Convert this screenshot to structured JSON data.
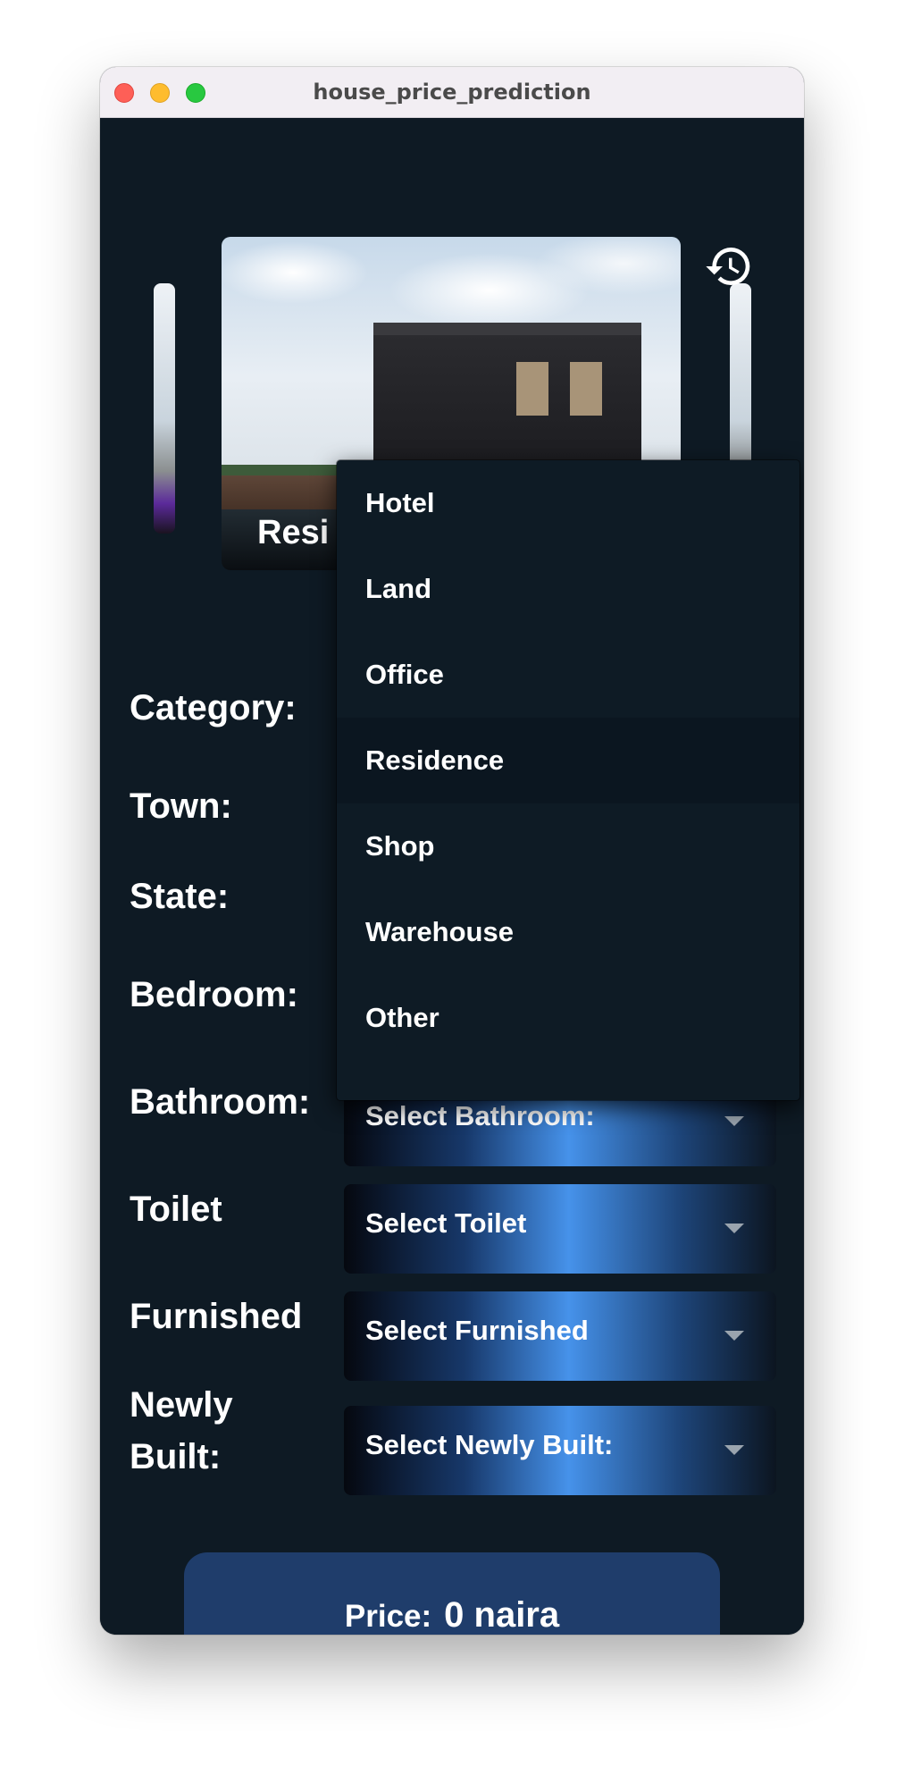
{
  "window": {
    "title": "house_price_prediction"
  },
  "carousel": {
    "current_card_label": "Resi"
  },
  "form": {
    "category_label": "Category:",
    "town_label": "Town:",
    "state_label": "State:",
    "bedroom_label": "Bedroom:",
    "bathroom_label": "Bathroom:",
    "bathroom_placeholder": "Select Bathroom:",
    "toilet_label": "Toilet",
    "toilet_placeholder": "Select Toilet",
    "furnished_label": "Furnished",
    "furnished_placeholder": "Select Furnished",
    "newly_built_label_line1": "Newly",
    "newly_built_label_line2": "Built:",
    "newly_built_placeholder": "Select Newly Built:"
  },
  "category_menu": {
    "items": [
      "Hotel",
      "Land",
      "Office",
      "Residence",
      "Shop",
      "Warehouse",
      "Other"
    ],
    "highlighted": "Residence"
  },
  "price": {
    "label": "Price:",
    "value": "0 naira"
  },
  "icons": {
    "history": "history-icon",
    "dropdown_caret": "caret-down-icon"
  }
}
